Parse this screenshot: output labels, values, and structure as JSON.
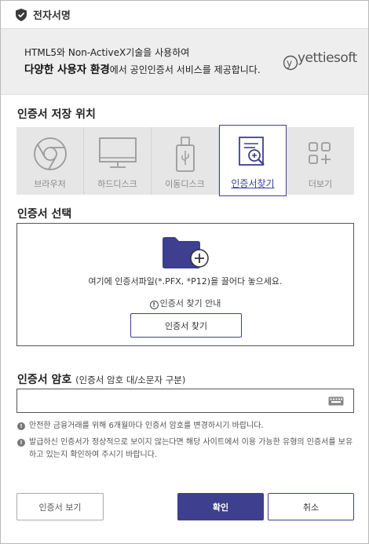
{
  "window": {
    "title": "전자서명",
    "icon": "shield-check-icon"
  },
  "banner": {
    "line1": "HTML5와 Non-ActiveX기술을 사용하여",
    "line2_bold": "다양한 사용자 환경",
    "line2_rest": "에서 공인인증서 서비스를 제공합니다.",
    "logo": "yettiesoft"
  },
  "storage": {
    "title": "인증서 저장 위치",
    "items": [
      {
        "label": "브라우저",
        "icon": "browser-icon",
        "active": false
      },
      {
        "label": "하드디스크",
        "icon": "monitor-icon",
        "active": false
      },
      {
        "label": "이동디스크",
        "icon": "usb-icon",
        "active": false
      },
      {
        "label": "인증서찾기",
        "icon": "cert-search-icon",
        "active": true
      },
      {
        "label": "더보기",
        "icon": "more-grid-icon",
        "active": false
      }
    ]
  },
  "select": {
    "title": "인증서 선택",
    "drop_hint": "여기에 인증서파일(*.PFX, *P12)을 끌어다 놓으세요.",
    "guide": "인증서 찾기 안내",
    "find_button": "인증서 찾기"
  },
  "password": {
    "title": "인증서 암호",
    "subtitle": "(인증서 암호 대/소문자 구분)",
    "value": "",
    "notes": [
      "안전한 금융거래를 위해 6개월마다 인증서 암호를 변경하시기 바랍니다.",
      "발급하신 인증서가 정상적으로 보이지 않는다면 해당 사이트에서 이용 가능한 유형의 인증서를 보유하고 있는지 확인하여 주시기 바랍니다."
    ]
  },
  "buttons": {
    "view": "인증서 보기",
    "ok": "확인",
    "cancel": "취소"
  },
  "colors": {
    "accent": "#3e3f8f",
    "folder": "#3e3f8f"
  }
}
